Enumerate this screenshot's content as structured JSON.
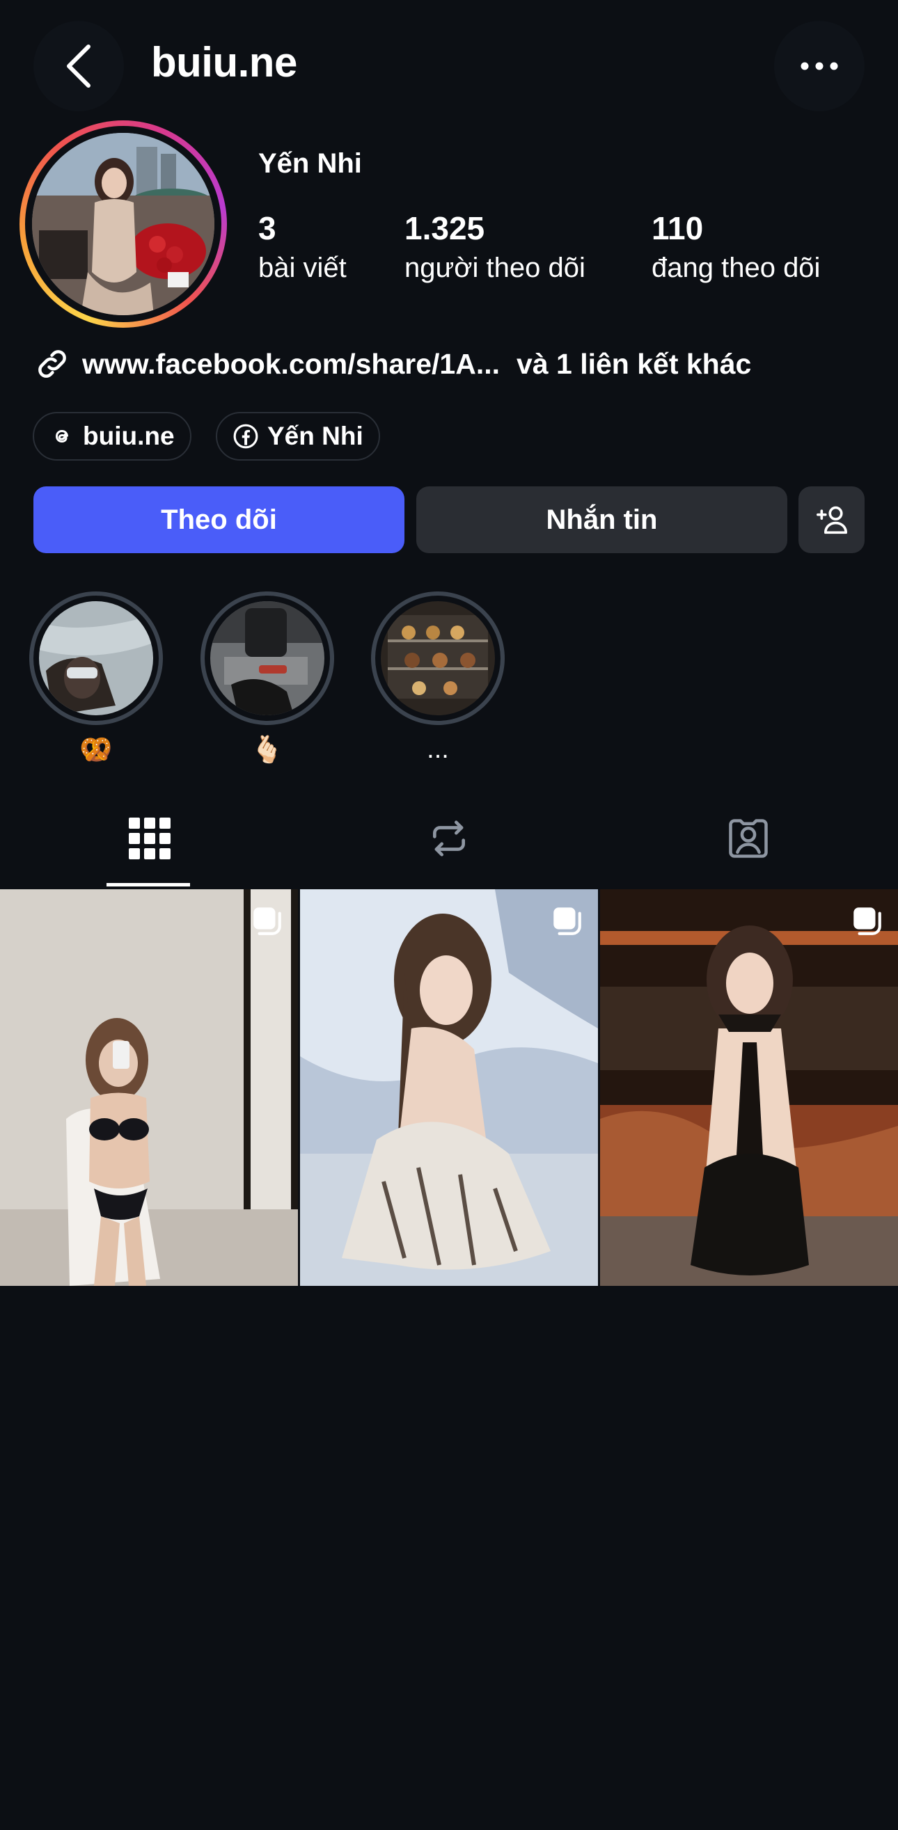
{
  "header": {
    "username": "buiu.ne",
    "back_icon": "chevron-left-icon",
    "more_icon": "ellipsis-icon"
  },
  "profile": {
    "display_name": "Yến Nhi",
    "stats": [
      {
        "value": "3",
        "label": "bài viết"
      },
      {
        "value": "1.325",
        "label": "người theo dõi"
      },
      {
        "value": "110",
        "label": "đang theo dõi"
      }
    ],
    "link_text": "www.facebook.com/share/1A...",
    "link_more": "và 1 liên kết khác",
    "link_icon": "link-icon"
  },
  "chips": [
    {
      "icon": "threads-icon",
      "label": "buiu.ne"
    },
    {
      "icon": "facebook-icon",
      "label": "Yến Nhi"
    }
  ],
  "actions": {
    "follow": "Theo dõi",
    "message": "Nhắn tin",
    "add_user_icon": "add-user-icon"
  },
  "highlights": [
    {
      "label": "🥨"
    },
    {
      "label": "🫰🏻"
    },
    {
      "label": "..."
    }
  ],
  "tabs": [
    {
      "icon": "grid-icon",
      "active": true
    },
    {
      "icon": "repost-icon",
      "active": false
    },
    {
      "icon": "tagged-icon",
      "active": false
    }
  ],
  "posts": [
    {
      "multi": true,
      "icon": "carousel-icon"
    },
    {
      "multi": true,
      "icon": "carousel-icon"
    },
    {
      "multi": true,
      "icon": "carousel-icon"
    }
  ],
  "colors": {
    "background": "#0c0f14",
    "follow_button": "#4a5df9",
    "message_button": "#2a2d33",
    "text": "#ffffff"
  }
}
